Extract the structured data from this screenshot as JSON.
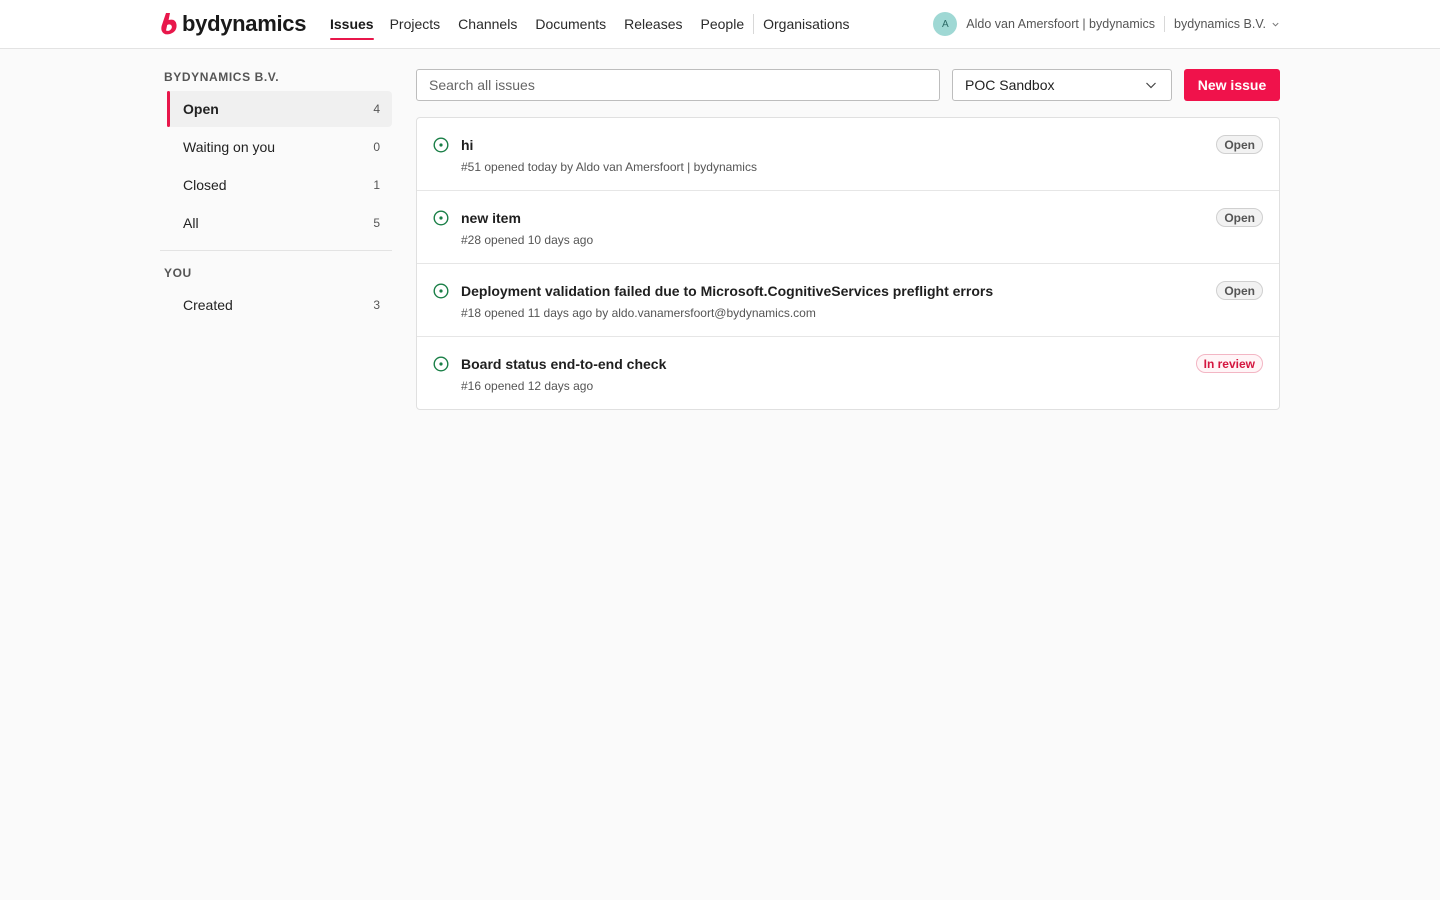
{
  "brand": {
    "name": "bydynamics",
    "accent": "#e8174b"
  },
  "nav": {
    "items": [
      {
        "label": "Issues",
        "active": true
      },
      {
        "label": "Projects"
      },
      {
        "label": "Channels"
      },
      {
        "label": "Documents"
      },
      {
        "label": "Releases"
      },
      {
        "label": "People"
      },
      {
        "label": "Organisations"
      }
    ]
  },
  "user": {
    "avatar_initial": "A",
    "name": "Aldo van Amersfoort | bydynamics",
    "org": "bydynamics B.V."
  },
  "sidebar": {
    "org_heading": "BYDYNAMICS B.V.",
    "filters": [
      {
        "label": "Open",
        "count": "4",
        "active": true
      },
      {
        "label": "Waiting on you",
        "count": "0"
      },
      {
        "label": "Closed",
        "count": "1"
      },
      {
        "label": "All",
        "count": "5"
      }
    ],
    "you_heading": "YOU",
    "you_items": [
      {
        "label": "Created",
        "count": "3"
      }
    ]
  },
  "toolbar": {
    "search_placeholder": "Search all issues",
    "project_selected": "POC Sandbox",
    "new_issue_label": "New issue"
  },
  "issues": [
    {
      "title": "hi",
      "meta": "#51 opened today by Aldo van Amersfoort | bydynamics",
      "status": "Open"
    },
    {
      "title": "new item",
      "meta": "#28 opened 10 days ago",
      "status": "Open"
    },
    {
      "title": "Deployment validation failed due to Microsoft.CognitiveServices preflight errors",
      "meta": "#18 opened 11 days ago by aldo.vanamersfoort@bydynamics.com",
      "status": "Open"
    },
    {
      "title": "Board status end-to-end check",
      "meta": "#16 opened 12 days ago",
      "status": "In review"
    }
  ]
}
